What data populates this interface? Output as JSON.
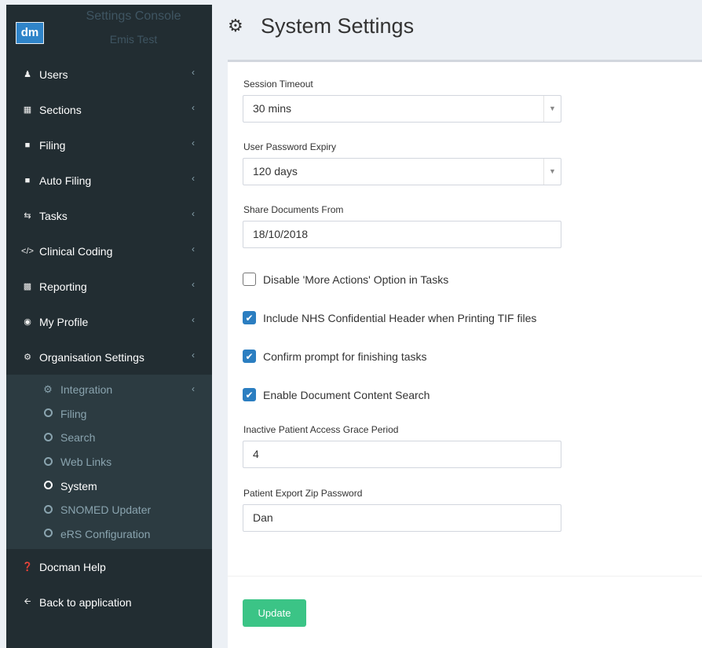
{
  "brand": {
    "logo": "dm",
    "title": "Settings Console",
    "subtitle": "Emis Test"
  },
  "sidebar": {
    "items": [
      {
        "label": "Users",
        "icon": "user-icon"
      },
      {
        "label": "Sections",
        "icon": "table-icon"
      },
      {
        "label": "Filing",
        "icon": "folder-icon"
      },
      {
        "label": "Auto Filing",
        "icon": "folder-icon"
      },
      {
        "label": "Tasks",
        "icon": "retweet-icon"
      },
      {
        "label": "Clinical Coding",
        "icon": "code-icon"
      },
      {
        "label": "Reporting",
        "icon": "bar-chart-icon"
      },
      {
        "label": "My Profile",
        "icon": "user-circle-icon"
      },
      {
        "label": "Organisation Settings",
        "icon": "cogs-icon"
      }
    ],
    "sub_items": [
      {
        "label": "Integration",
        "icon": "cogs-icon"
      },
      {
        "label": "Filing",
        "icon": "circle-icon"
      },
      {
        "label": "Search",
        "icon": "circle-icon"
      },
      {
        "label": "Web Links",
        "icon": "circle-icon"
      },
      {
        "label": "System",
        "icon": "circle-icon",
        "active": true
      },
      {
        "label": "SNOMED Updater",
        "icon": "circle-icon"
      },
      {
        "label": "eRS Configuration",
        "icon": "circle-icon"
      }
    ],
    "bottom_items": [
      {
        "label": "Docman Help",
        "icon": "question-icon"
      },
      {
        "label": "Back to application",
        "icon": "arrow-left-icon"
      }
    ]
  },
  "header": {
    "title": "System Settings",
    "icon": "cogs-icon"
  },
  "form": {
    "session_timeout": {
      "label": "Session Timeout",
      "value": "30 mins"
    },
    "password_expiry": {
      "label": "User Password Expiry",
      "value": "120 days"
    },
    "share_documents": {
      "label": "Share Documents From",
      "value": "18/10/2018"
    },
    "checkboxes": [
      {
        "label": "Disable 'More Actions' Option in Tasks",
        "checked": false
      },
      {
        "label": "Include NHS Confidential Header when Printing TIF files",
        "checked": true
      },
      {
        "label": "Confirm prompt for finishing tasks",
        "checked": true
      },
      {
        "label": "Enable Document Content Search",
        "checked": true
      }
    ],
    "grace_period": {
      "label": "Inactive Patient Access Grace Period",
      "value": "4"
    },
    "zip_password": {
      "label": "Patient Export Zip Password",
      "value": "Dan"
    },
    "update_label": "Update"
  },
  "colors": {
    "sidebar_bg": "#222d32",
    "submenu_bg": "#2c3b41",
    "checkbox": "#2b7ec1",
    "update_button": "#3bc486"
  }
}
